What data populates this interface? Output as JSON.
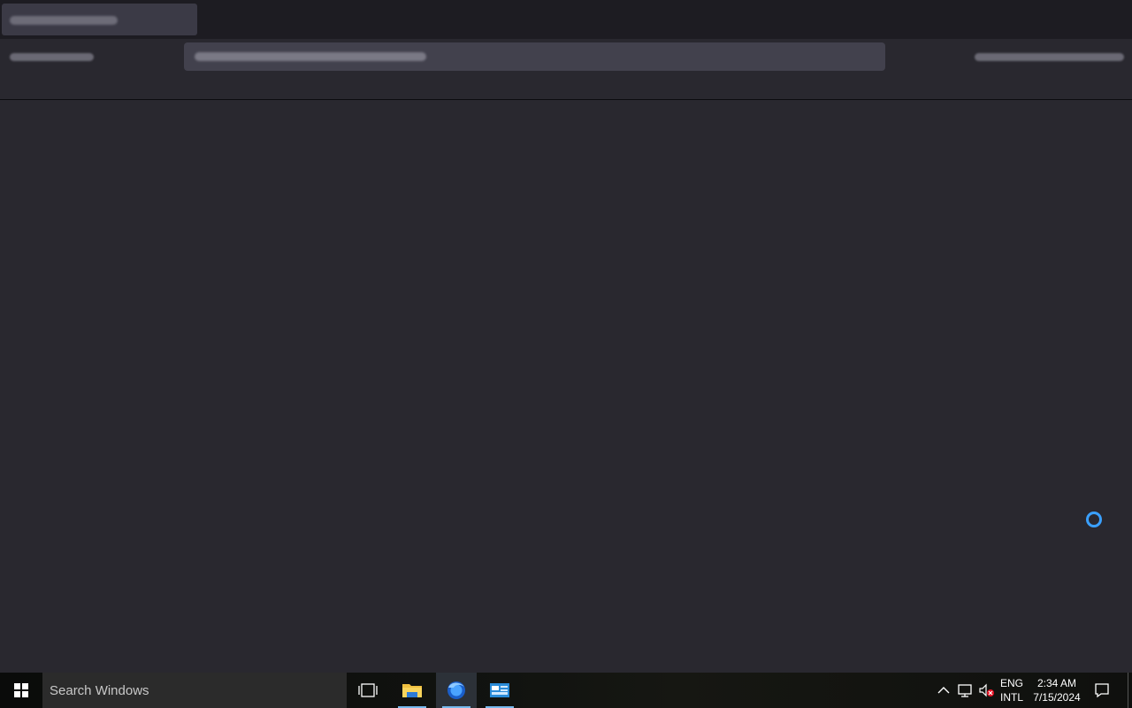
{
  "taskbar": {
    "search_placeholder": "Search Windows",
    "apps": [
      "task-view",
      "file-explorer",
      "firefox",
      "app"
    ],
    "tray": {
      "lang_line1": "ENG",
      "lang_line2": "INTL",
      "time": "2:34 AM",
      "date": "7/15/2024"
    }
  },
  "colors": {
    "accent": "#3aa0ff",
    "taskbar_active_underline": "#76b9ed",
    "window_bg": "#29282f"
  }
}
